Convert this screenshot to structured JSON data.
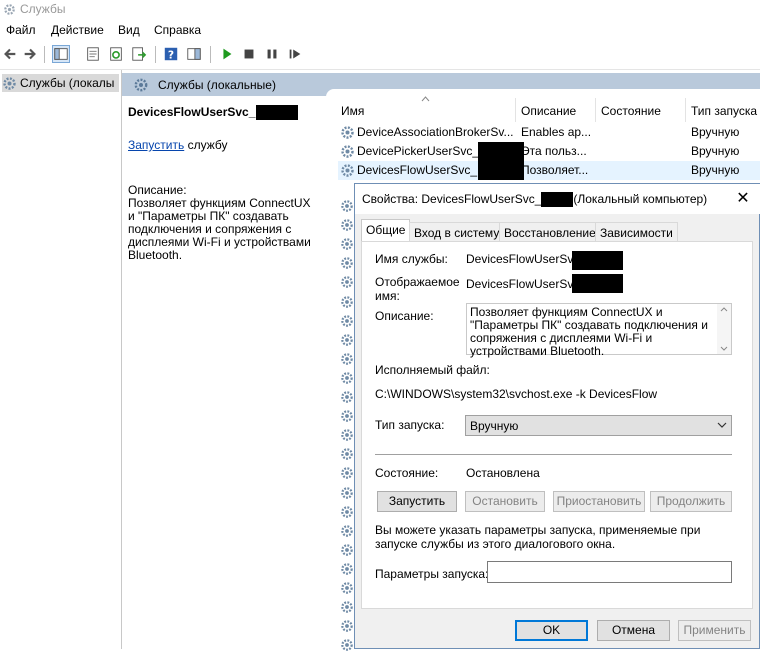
{
  "window": {
    "title": "Службы"
  },
  "menu": {
    "items": [
      "Файл",
      "Действие",
      "Вид",
      "Справка"
    ]
  },
  "tree": {
    "root_label": "Службы (локалы"
  },
  "main": {
    "header_label": "Службы (локальные)"
  },
  "description_panel": {
    "service_name": "DevicesFlowUserSvc_",
    "start_link": "Запустить",
    "start_suffix": " службу",
    "desc_label": "Описание:",
    "desc_text": "Позволяет функциям ConnectUX и \"Параметры ПК\" создавать подключения и сопряжения с дисплеями Wi-Fi и устройствами Bluetooth."
  },
  "list": {
    "columns": [
      "Имя",
      "Описание",
      "Состояние",
      "Тип запуска"
    ],
    "rows": [
      {
        "name": "DeviceAssociationBrokerSv...",
        "desc": "Enables ap...",
        "state": "",
        "startup": "Вручную"
      },
      {
        "name": "DevicePickerUserSvc_",
        "desc": "Эта польз...",
        "state": "",
        "startup": "Вручную"
      },
      {
        "name": "DevicesFlowUserSvc_",
        "desc": "Позволяет...",
        "state": "",
        "startup": "Вручную"
      }
    ]
  },
  "dialog": {
    "title_prefix": "Свойства: DevicesFlowUserSvc_",
    "title_suffix": "(Локальный компьютер)",
    "close_glyph": "✕",
    "tabs": [
      "Общие",
      "Вход в систему",
      "Восстановление",
      "Зависимости"
    ],
    "service_name_label": "Имя службы:",
    "service_name_value": "DevicesFlowUserSvc_",
    "display_name_label_1": "Отображаемое",
    "display_name_label_2": "имя:",
    "display_name_value": "DevicesFlowUserSvc_",
    "description_label": "Описание:",
    "description_value": "Позволяет функциям ConnectUX и \"Параметры ПК\" создавать подключения и сопряжения с дисплеями Wi-Fi и устройствами Bluetooth.",
    "exe_label": "Исполняемый файл:",
    "exe_path": "C:\\WINDOWS\\system32\\svchost.exe -k DevicesFlow",
    "startup_type_label": "Тип запуска:",
    "startup_type_value": "Вручную",
    "status_label": "Состояние:",
    "status_value": "Остановлена",
    "btn_start": "Запустить",
    "btn_stop": "Остановить",
    "btn_pause": "Приостановить",
    "btn_resume": "Продолжить",
    "hint_text": "Вы можете указать параметры запуска, применяемые при запуске службы из этого диалогового окна.",
    "params_label": "Параметры запуска:",
    "params_value": "",
    "btn_ok": "OK",
    "btn_cancel": "Отмена",
    "btn_apply": "Применить"
  },
  "colors": {
    "header_strip": "#b9c9db",
    "selected_row": "#e5f3ff",
    "link": "#0645ad",
    "accent": "#0078d7"
  }
}
